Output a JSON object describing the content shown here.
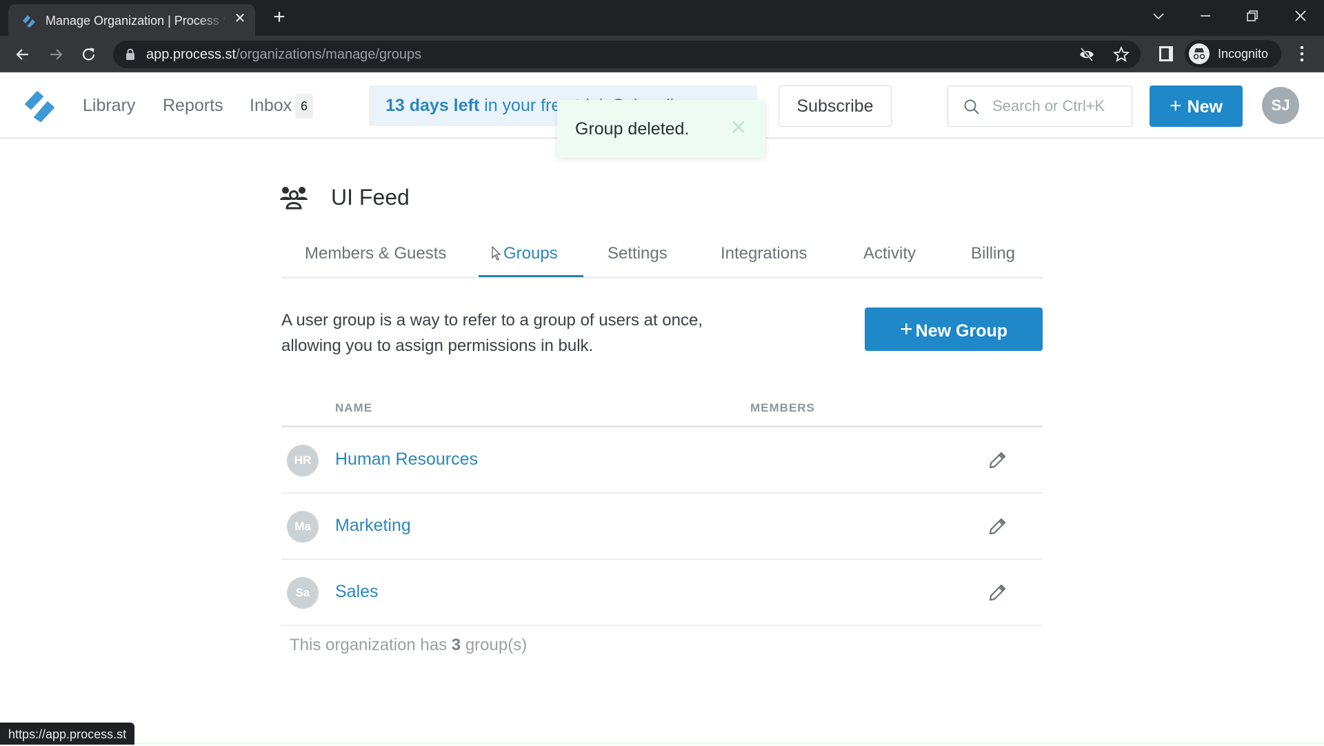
{
  "browser": {
    "tab_title": "Manage Organization | Process Street",
    "url_host": "app.process.st",
    "url_path": "/organizations/manage/groups",
    "profile_label": "Incognito",
    "status_url": "https://app.process.st"
  },
  "header": {
    "nav": [
      {
        "label": "Library"
      },
      {
        "label": "Reports"
      },
      {
        "label": "Inbox"
      }
    ],
    "inbox_count": "6",
    "trial_bold": "13 days left",
    "trial_rest": " in your free trial. Subscribe now",
    "subscribe_label": "Subscribe",
    "search_placeholder": "Search or Ctrl+K",
    "new_label": "New",
    "avatar_initials": "SJ",
    "brand_color": "#1e88c8"
  },
  "toast": {
    "message": "Group deleted.",
    "close_glyph": "✕"
  },
  "org": {
    "name": "UI Feed",
    "tabs": [
      {
        "label": "Members & Guests",
        "active": false
      },
      {
        "label": "Groups",
        "active": true
      },
      {
        "label": "Settings",
        "active": false
      },
      {
        "label": "Integrations",
        "active": false
      },
      {
        "label": "Activity",
        "active": false
      },
      {
        "label": "Billing",
        "active": false
      }
    ]
  },
  "groups": {
    "description_line1": "A user group is a way to refer to a group of users at once,",
    "description_line2": "allowing you to assign permissions in bulk.",
    "new_group_label": "New Group",
    "columns": {
      "name": "NAME",
      "members": "MEMBERS"
    },
    "rows": [
      {
        "initials": "HR",
        "name": "Human Resources"
      },
      {
        "initials": "Ma",
        "name": "Marketing"
      },
      {
        "initials": "Sa",
        "name": "Sales"
      }
    ],
    "footer_prefix": "This organization has ",
    "footer_count": "3",
    "footer_suffix": " group(s)"
  }
}
